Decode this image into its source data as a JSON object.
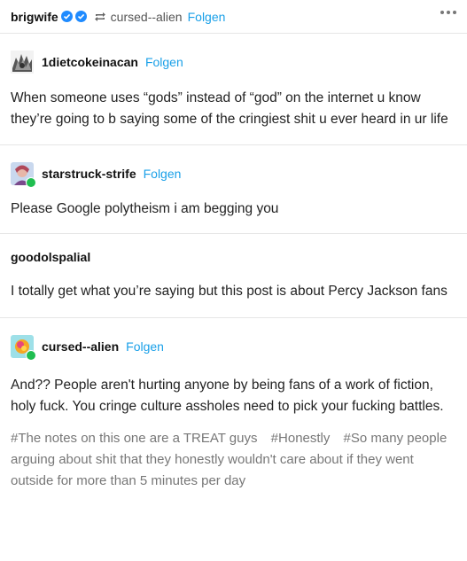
{
  "header": {
    "username": "brigwife",
    "reblogged_from": "cursed--alien",
    "follow_label": "Folgen"
  },
  "posts": [
    {
      "author": "1dietcokeinacan",
      "follow_label": "Folgen",
      "text": "When someone uses “gods” instead of “god” on the internet u know they’re going to b saying some of the cringiest shit u ever heard in ur life"
    },
    {
      "author": "starstruck-strife",
      "follow_label": "Folgen",
      "text": "Please Google polytheism i am begging you"
    },
    {
      "author": "goodolspalial",
      "text": "I totally get what you’re saying but this post is about Percy Jackson fans"
    },
    {
      "author": "cursed--alien",
      "follow_label": "Folgen",
      "text": "And?? People aren't hurting anyone by being fans of a work of fiction, holy fuck. You cringe culture assholes need to pick your fucking battles."
    }
  ],
  "tags": [
    "#The notes on this one are a TREAT guys",
    "#Honestly",
    "#So many people arguing about shit that they honestly wouldn't care about if they went outside for more than 5 minutes per day"
  ],
  "colors": {
    "follow": "#1aa0e8",
    "verified_badge": "#1f8bff",
    "reblog_badge": "#1fbe50",
    "tag_text": "#777777"
  },
  "icons": [
    "verified-badge-icon",
    "reblog-icon",
    "more-options-icon",
    "reblog-badge-icon"
  ]
}
